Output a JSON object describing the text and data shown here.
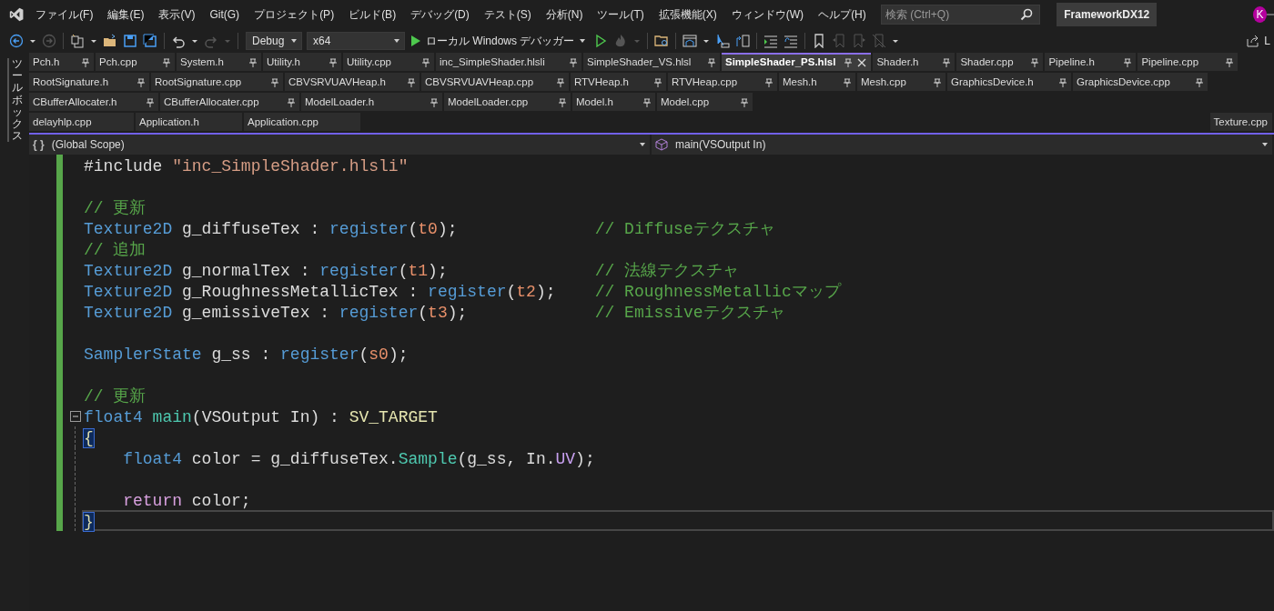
{
  "menu": [
    "ファイル(F)",
    "編集(E)",
    "表示(V)",
    "Git(G)",
    "プロジェクト(P)",
    "ビルド(B)",
    "デバッグ(D)",
    "テスト(S)",
    "分析(N)",
    "ツール(T)",
    "拡張機能(X)",
    "ウィンドウ(W)",
    "ヘルプ(H)"
  ],
  "search": {
    "placeholder": "検索 (Ctrl+Q)"
  },
  "solution_name": "FrameworkDX12",
  "avatar": "K",
  "toolbar": {
    "left": [
      {
        "kind": "back",
        "disabled": false
      },
      {
        "kind": "caret",
        "disabled": false
      },
      {
        "kind": "forward",
        "disabled": true
      },
      {
        "kind": "sep"
      },
      {
        "kind": "new",
        "disabled": false
      },
      {
        "kind": "caret",
        "disabled": false
      },
      {
        "kind": "open",
        "disabled": false
      },
      {
        "kind": "save",
        "disabled": false
      },
      {
        "kind": "save_all",
        "disabled": false
      },
      {
        "kind": "sep"
      },
      {
        "kind": "undo",
        "disabled": false
      },
      {
        "kind": "caret",
        "disabled": false
      },
      {
        "kind": "redo",
        "disabled": true
      },
      {
        "kind": "caret",
        "disabled": true
      },
      {
        "kind": "sep"
      }
    ],
    "configuration": "Debug",
    "platform": "x64",
    "start_label": "ローカル Windows デバッガー",
    "right": [
      {
        "kind": "play_outline",
        "disabled": false
      },
      {
        "kind": "flame",
        "disabled": true
      },
      {
        "kind": "caret",
        "disabled": true
      },
      {
        "kind": "sep"
      },
      {
        "kind": "folder_search",
        "disabled": false
      },
      {
        "kind": "sep"
      },
      {
        "kind": "window",
        "disabled": false
      },
      {
        "kind": "caret",
        "disabled": false
      },
      {
        "kind": "pointer",
        "disabled": false
      },
      {
        "kind": "swap",
        "disabled": false
      },
      {
        "kind": "sep"
      },
      {
        "kind": "indent",
        "disabled": false
      },
      {
        "kind": "outdent",
        "disabled": false
      },
      {
        "kind": "sep"
      },
      {
        "kind": "bookmark",
        "disabled": false
      },
      {
        "kind": "bookmark_prev",
        "disabled": true
      },
      {
        "kind": "bookmark_next",
        "disabled": true
      },
      {
        "kind": "bookmark_clear",
        "disabled": true
      },
      {
        "kind": "caret",
        "disabled": false
      }
    ],
    "share_label": "L"
  },
  "toolbox_label": "ツールボックス",
  "tab_rows": [
    {
      "tabs": [
        {
          "label": "Pch.h",
          "pinned": true,
          "selected": false
        },
        {
          "label": "Pch.cpp",
          "pinned": true,
          "selected": false
        },
        {
          "label": "System.h",
          "pinned": true,
          "selected": false
        },
        {
          "label": "Utility.h",
          "pinned": true,
          "selected": false
        },
        {
          "label": "Utility.cpp",
          "pinned": true,
          "selected": false
        },
        {
          "label": "inc_SimpleShader.hlsli",
          "pinned": true,
          "selected": false
        },
        {
          "label": "SimpleShader_VS.hlsl",
          "pinned": true,
          "selected": false
        },
        {
          "label": "SimpleShader_PS.hlsl",
          "pinned": true,
          "selected": true
        },
        {
          "label": "Shader.h",
          "pinned": true,
          "selected": false
        },
        {
          "label": "Shader.cpp",
          "pinned": true,
          "selected": false
        },
        {
          "label": "Pipeline.h",
          "pinned": true,
          "selected": false
        },
        {
          "label": "Pipeline.cpp",
          "pinned": true,
          "selected": false
        }
      ]
    },
    {
      "tabs": [
        {
          "label": "RootSignature.h",
          "pinned": true,
          "selected": false
        },
        {
          "label": "RootSignature.cpp",
          "pinned": true,
          "selected": false
        },
        {
          "label": "CBVSRVUAVHeap.h",
          "pinned": true,
          "selected": false
        },
        {
          "label": "CBVSRVUAVHeap.cpp",
          "pinned": true,
          "selected": false
        },
        {
          "label": "RTVHeap.h",
          "pinned": true,
          "selected": false
        },
        {
          "label": "RTVHeap.cpp",
          "pinned": true,
          "selected": false
        },
        {
          "label": "Mesh.h",
          "pinned": true,
          "selected": false
        },
        {
          "label": "Mesh.cpp",
          "pinned": true,
          "selected": false
        },
        {
          "label": "GraphicsDevice.h",
          "pinned": true,
          "selected": false
        },
        {
          "label": "GraphicsDevice.cpp",
          "pinned": true,
          "selected": false
        }
      ]
    },
    {
      "tabs": [
        {
          "label": "CBufferAllocater.h",
          "pinned": true,
          "selected": false
        },
        {
          "label": "CBufferAllocater.cpp",
          "pinned": true,
          "selected": false
        },
        {
          "label": "ModelLoader.h",
          "pinned": true,
          "selected": false
        },
        {
          "label": "ModelLoader.cpp",
          "pinned": true,
          "selected": false
        },
        {
          "label": "Model.h",
          "pinned": true,
          "selected": false
        },
        {
          "label": "Model.cpp",
          "pinned": true,
          "selected": false
        }
      ]
    },
    {
      "tabs": [
        {
          "label": "delayhlp.cpp",
          "pinned": false,
          "selected": false
        },
        {
          "label": "Application.h",
          "pinned": false,
          "selected": false
        },
        {
          "label": "Application.cpp",
          "pinned": false,
          "selected": false
        }
      ],
      "right_tabs": [
        {
          "label": "Texture.cpp",
          "pinned": false,
          "selected": false
        }
      ]
    }
  ],
  "navigation": {
    "scope_icon": "{ }",
    "scope": "(Global Scope)",
    "member": "main(VSOutput In)"
  },
  "code": [
    {
      "modified": true,
      "current": false,
      "tokens": [
        {
          "kind": "plain",
          "text": "#include "
        },
        {
          "kind": "string",
          "text": "\"inc_SimpleShader.hlsli\""
        }
      ]
    },
    {
      "modified": true,
      "current": false
    },
    {
      "modified": true,
      "current": false,
      "tokens": [
        {
          "kind": "comment",
          "text": "// 更新"
        }
      ]
    },
    {
      "modified": true,
      "current": false,
      "tokens": [
        {
          "kind": "type",
          "text": "Texture2D"
        },
        {
          "kind": "plain",
          "text": " g_diffuseTex : "
        },
        {
          "kind": "type",
          "text": "register"
        },
        {
          "kind": "plain",
          "text": "("
        },
        {
          "kind": "register",
          "text": "t0"
        },
        {
          "kind": "plain",
          "text": ");"
        }
      ],
      "comment": "// Diffuseテクスチャ"
    },
    {
      "modified": true,
      "current": false,
      "tokens": [
        {
          "kind": "comment",
          "text": "// 追加"
        }
      ]
    },
    {
      "modified": true,
      "current": false,
      "tokens": [
        {
          "kind": "type",
          "text": "Texture2D"
        },
        {
          "kind": "plain",
          "text": " g_normalTex : "
        },
        {
          "kind": "type",
          "text": "register"
        },
        {
          "kind": "plain",
          "text": "("
        },
        {
          "kind": "register",
          "text": "t1"
        },
        {
          "kind": "plain",
          "text": ");"
        }
      ],
      "comment": "// 法線テクスチャ"
    },
    {
      "modified": true,
      "current": false,
      "tokens": [
        {
          "kind": "type",
          "text": "Texture2D"
        },
        {
          "kind": "plain",
          "text": " g_RoughnessMetallicTex : "
        },
        {
          "kind": "type",
          "text": "register"
        },
        {
          "kind": "plain",
          "text": "("
        },
        {
          "kind": "register",
          "text": "t2"
        },
        {
          "kind": "plain",
          "text": ");"
        }
      ],
      "comment": "// RoughnessMetallicマップ"
    },
    {
      "modified": true,
      "current": false,
      "tokens": [
        {
          "kind": "type",
          "text": "Texture2D"
        },
        {
          "kind": "plain",
          "text": " g_emissiveTex : "
        },
        {
          "kind": "type",
          "text": "register"
        },
        {
          "kind": "plain",
          "text": "("
        },
        {
          "kind": "register",
          "text": "t3"
        },
        {
          "kind": "plain",
          "text": ");"
        }
      ],
      "comment": "// Emissiveテクスチャ"
    },
    {
      "modified": true,
      "current": false
    },
    {
      "modified": true,
      "current": false,
      "tokens": [
        {
          "kind": "type",
          "text": "SamplerState"
        },
        {
          "kind": "plain",
          "text": " g_ss : "
        },
        {
          "kind": "type",
          "text": "register"
        },
        {
          "kind": "plain",
          "text": "("
        },
        {
          "kind": "register",
          "text": "s0"
        },
        {
          "kind": "plain",
          "text": ");"
        }
      ]
    },
    {
      "modified": true,
      "current": false
    },
    {
      "modified": true,
      "current": false,
      "tokens": [
        {
          "kind": "comment",
          "text": "// 更新"
        }
      ]
    },
    {
      "modified": true,
      "current": false,
      "expanded": true,
      "tokens": [
        {
          "kind": "type",
          "text": "float4"
        },
        {
          "kind": "func",
          "text": " main"
        },
        {
          "kind": "plain",
          "text": "(VSOutput In) : "
        },
        {
          "kind": "semantic",
          "text": "SV_TARGET"
        }
      ],
      "children": [
        {
          "modified": true,
          "current": false,
          "indented": false,
          "tokens": [
            {
              "kind": "brace_match",
              "text": "{"
            }
          ]
        },
        {
          "modified": true,
          "current": false,
          "indented": true,
          "tokens": [
            {
              "kind": "type",
              "text": "float4"
            },
            {
              "kind": "plain",
              "text": " color = g_diffuseTex."
            },
            {
              "kind": "func",
              "text": "Sample"
            },
            {
              "kind": "plain",
              "text": "(g_ss, In."
            },
            {
              "kind": "field",
              "text": "UV"
            },
            {
              "kind": "plain",
              "text": ");"
            }
          ]
        },
        {
          "modified": true,
          "current": false,
          "indented": false
        },
        {
          "modified": true,
          "current": false,
          "indented": true,
          "tokens": [
            {
              "kind": "control",
              "text": "return"
            },
            {
              "kind": "plain",
              "text": " color;"
            }
          ]
        },
        {
          "modified": true,
          "current": true,
          "indented": false,
          "tokens": [
            {
              "kind": "brace_match",
              "text": "}"
            }
          ]
        }
      ]
    }
  ]
}
